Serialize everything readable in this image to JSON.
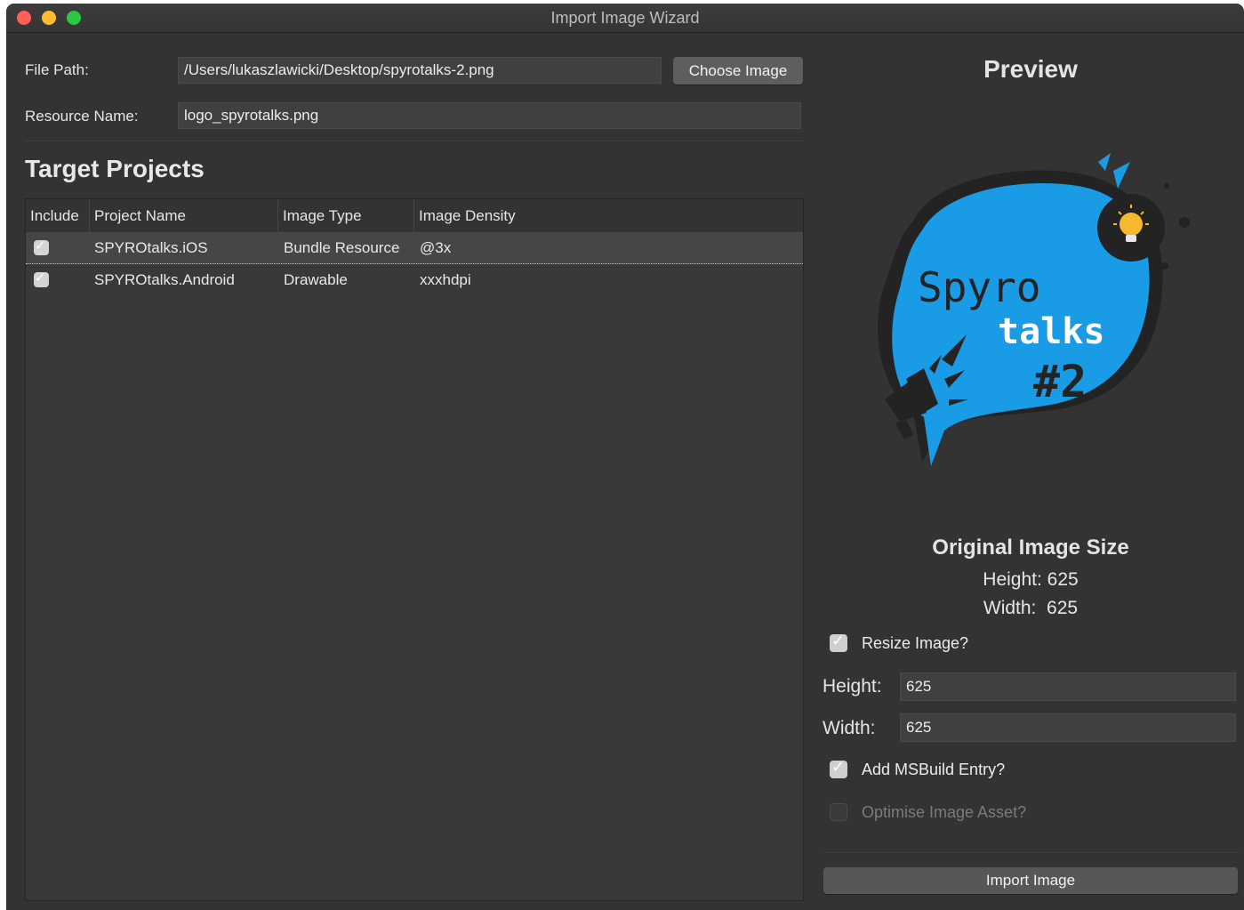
{
  "window": {
    "title": "Import Image Wizard"
  },
  "form": {
    "file_path_label": "File Path:",
    "file_path_value": "/Users/lukaszlawicki/Desktop/spyrotalks-2.png",
    "choose_button": "Choose Image",
    "resource_name_label": "Resource Name:",
    "resource_name_value": "logo_spyrotalks.png"
  },
  "target_projects": {
    "title": "Target Projects",
    "columns": [
      "Include",
      "Project Name",
      "Image Type",
      "Image Density"
    ],
    "rows": [
      {
        "include": true,
        "project": "SPYROtalks.iOS",
        "type": "Bundle Resource",
        "density": "@3x"
      },
      {
        "include": true,
        "project": "SPYROtalks.Android",
        "type": "Drawable",
        "density": "xxxhdpi"
      }
    ]
  },
  "preview": {
    "title": "Preview",
    "logo_line1": "Spyro",
    "logo_line2": "talks",
    "logo_line3": "#2",
    "logo_color": "#1a9be6",
    "bulb_color": "#f5b82e",
    "original_size_title": "Original Image Size",
    "height_text": "Height: 625",
    "width_text": "Width:  625"
  },
  "options": {
    "resize_label": "Resize Image?",
    "resize_checked": true,
    "height_label": "Height:",
    "height_value": "625",
    "width_label": "Width:",
    "width_value": "625",
    "msbuild_label": "Add MSBuild Entry?",
    "msbuild_checked": true,
    "optimise_label": "Optimise Image Asset?",
    "optimise_checked": false,
    "import_button": "Import Image"
  }
}
